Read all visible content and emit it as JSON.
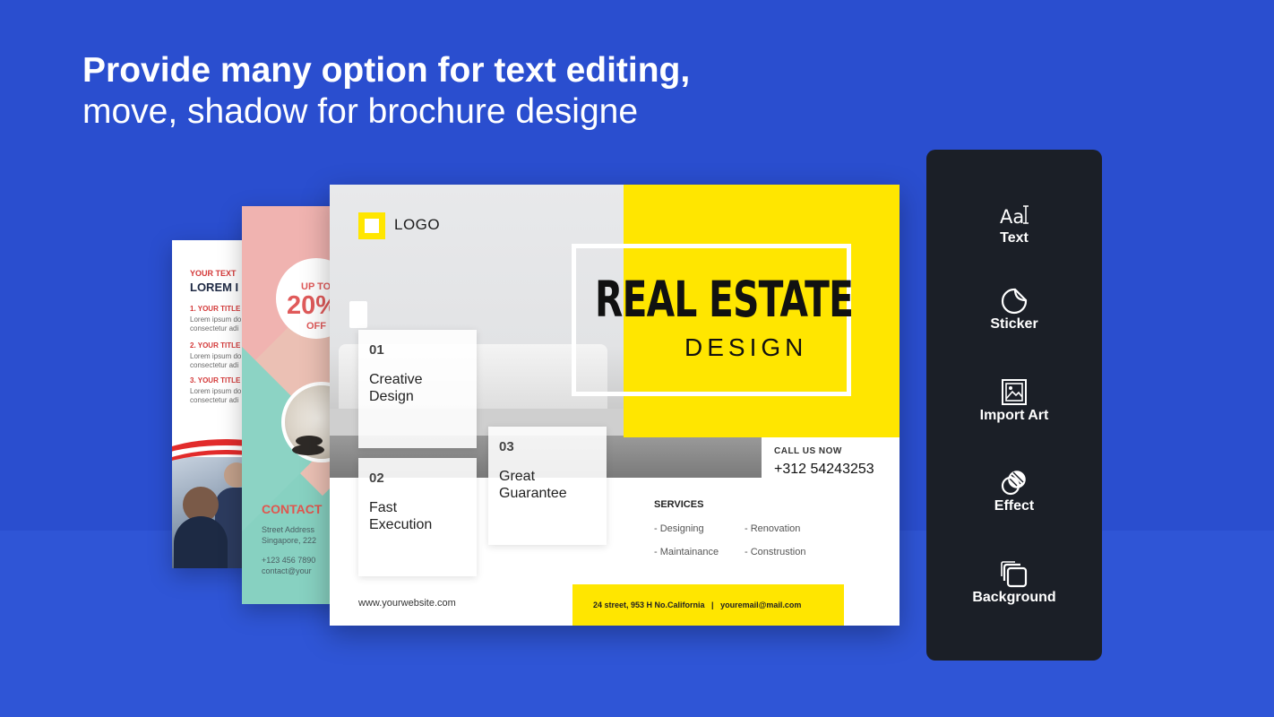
{
  "headline": {
    "line1": "Provide many option for text editing,",
    "line2": "move, shadow for brochure designe"
  },
  "brochure_back1": {
    "your_text": "YOUR TEXT",
    "lorem": "LOREM I",
    "items": [
      {
        "title": "1. YOUR TITLE",
        "lines": [
          "Lorem ipsum do",
          "consectetur adi"
        ]
      },
      {
        "title": "2. YOUR TITLE",
        "lines": [
          "Lorem ipsum do",
          "consectetur adi"
        ]
      },
      {
        "title": "3. YOUR TITLE",
        "lines": [
          "Lorem ipsum do",
          "consectetur adi"
        ]
      }
    ]
  },
  "brochure_back2": {
    "up_to": "UP TO",
    "percent": "20%",
    "off": "OFF",
    "contact": "CONTACT",
    "address1": "Street Address",
    "address2": "Singapore, 222",
    "phone": "+123 456 7890",
    "email": "contact@your"
  },
  "brochure_main": {
    "logo": "LOGO",
    "title": "REAL ESTATE",
    "subtitle": "DESIGN",
    "boxes": [
      {
        "num": "01",
        "label": "Creative\nDesign"
      },
      {
        "num": "02",
        "label": "Fast\nExecution"
      },
      {
        "num": "03",
        "label": "Great\nGuarantee"
      }
    ],
    "call_us": "CALL US NOW",
    "phone": "+312 54243253",
    "services_title": "SERVICES",
    "services": [
      "- Designing",
      "- Renovation",
      "- Maintainance",
      "- Construstion"
    ],
    "website": "www.yourwebsite.com",
    "footer": "24 street, 953 H No.California   |   youremail@mail.com"
  },
  "tools": [
    {
      "label": "Text",
      "icon": "text-icon"
    },
    {
      "label": "Sticker",
      "icon": "sticker-icon"
    },
    {
      "label": "Import Art",
      "icon": "import-art-icon"
    },
    {
      "label": "Effect",
      "icon": "effect-icon"
    },
    {
      "label": "Background",
      "icon": "background-icon"
    }
  ],
  "colors": {
    "background": "#2a4ecf",
    "accent_yellow": "#ffe600",
    "panel": "#1b1f27",
    "accent_red": "#e22b2b"
  }
}
